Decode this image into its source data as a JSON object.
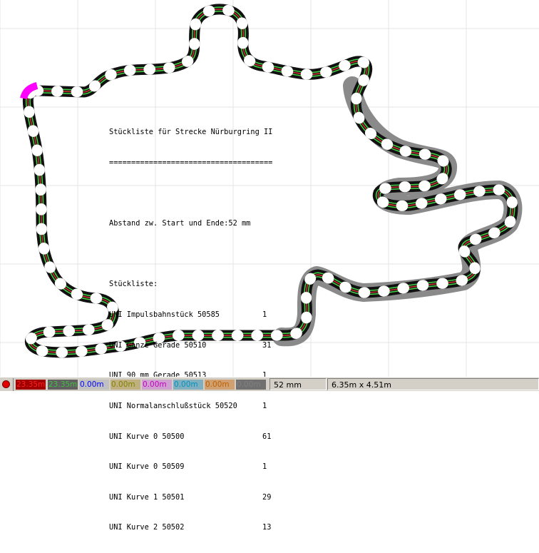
{
  "bom": {
    "title": "Stückliste für Strecke Nürburgring II",
    "underline": "=====================================",
    "distance_text": "Abstand zw. Start und Ende:52 mm",
    "list_heading": "Stückliste:",
    "parts": [
      {
        "name": "UNI Impulsbahnstück 50585",
        "qty": "1"
      },
      {
        "name": "UNI Ganze Gerade 50510",
        "qty": "31"
      },
      {
        "name": "UNI 90 mm Gerade 50513",
        "qty": "1"
      },
      {
        "name": "UNI Normalanschlußstück 50520",
        "qty": "1"
      },
      {
        "name": "UNI Kurve 0 50500",
        "qty": "61"
      },
      {
        "name": "UNI Kurve 0 50509",
        "qty": "1"
      },
      {
        "name": "UNI Kurve 1 50501",
        "qty": "29"
      },
      {
        "name": "UNI Kurve 2 50502",
        "qty": "13"
      }
    ]
  },
  "statusbar": {
    "lanes": [
      {
        "value": "23.35m",
        "fg": "#ff2020",
        "bg": "#a00000"
      },
      {
        "value": "23.35m",
        "fg": "#40c040",
        "bg": "#606060"
      },
      {
        "value": "0.00m",
        "fg": "#0000ff",
        "bg": "#c0c0c0"
      },
      {
        "value": "0.00m",
        "fg": "#808000",
        "bg": "#c0b080"
      },
      {
        "value": "0.00m",
        "fg": "#c000c0",
        "bg": "#d0a0d0"
      },
      {
        "value": "0.00m",
        "fg": "#0090c0",
        "bg": "#80b0c0"
      },
      {
        "value": "0.00m",
        "fg": "#c06000",
        "bg": "#d0a070"
      },
      {
        "value": "0.00m",
        "fg": "#808080",
        "bg": "#707070"
      }
    ],
    "gap": "52 mm",
    "dimensions": "6.35m x 4.51m"
  },
  "colors": {
    "track": "#111111",
    "lane_green": "#46d046",
    "lane_red": "#d03030",
    "highlight": "#8a8a8a",
    "start_marker": "#ff00ff"
  }
}
